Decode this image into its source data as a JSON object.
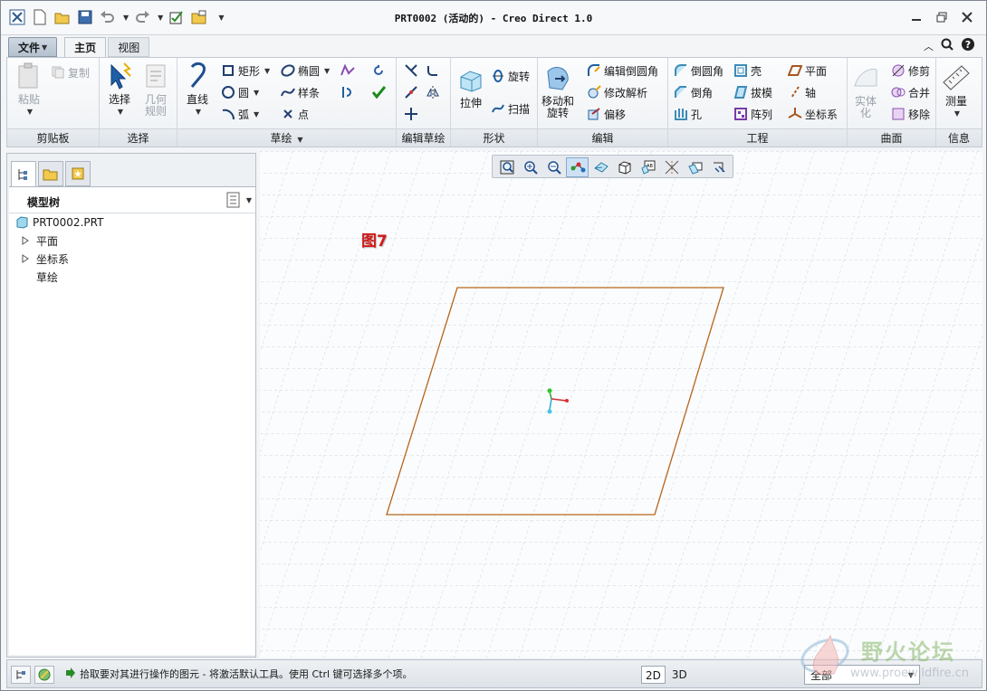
{
  "window": {
    "title": "PRT0002 (活动的) - Creo Direct 1.0"
  },
  "tabs": {
    "file": "文件",
    "home": "主页",
    "view": "视图"
  },
  "ribbon": {
    "clipboard": {
      "label": "剪贴板",
      "paste": "粘贴",
      "copy": "复制"
    },
    "select": {
      "label": "选择",
      "select": "选择",
      "geometry_rules": "几何\n规则"
    },
    "sketch": {
      "label": "草绘",
      "line": "直线",
      "rectangle": "矩形",
      "circle": "圆",
      "arc": "弧",
      "ellipse": "椭圆",
      "spline": "样条",
      "point": "点"
    },
    "edit_sketch": {
      "label": "编辑草绘"
    },
    "shapes": {
      "label": "形状",
      "extrude": "拉伸",
      "revolve": "旋转",
      "sweep": "扫描"
    },
    "edit": {
      "label": "编辑",
      "move_rotate": "移动和\n旋转",
      "edit_round": "编辑倒圆角",
      "modify_analytic": "修改解析",
      "offset": "偏移"
    },
    "engineering": {
      "label": "工程",
      "round": "倒圆角",
      "chamfer": "倒角",
      "hole": "孔",
      "shell": "壳",
      "draft": "拔模",
      "pattern": "阵列",
      "plane": "平面",
      "axis": "轴",
      "csys": "坐标系"
    },
    "surfaces": {
      "label": "曲面",
      "solidify": "实体\n化",
      "trim": "修剪",
      "merge": "合并",
      "remove": "移除"
    },
    "info": {
      "label": "信息",
      "measure": "测量"
    }
  },
  "model_tree": {
    "title": "模型树",
    "items": [
      {
        "label": "PRT0002.PRT"
      },
      {
        "label": "平面"
      },
      {
        "label": "坐标系"
      },
      {
        "label": "草绘"
      }
    ]
  },
  "canvas": {
    "figure_label": "图7"
  },
  "status": {
    "message": "拾取要对其进行操作的图元 - 将激活默认工具。使用 Ctrl 键可选择多个项。",
    "mode_2d": "2D",
    "mode_3d": "3D",
    "filter": "全部"
  },
  "watermark": {
    "name": "野火论坛",
    "url": "www.proewildfire.cn"
  },
  "colors": {
    "sketch_line": "#b5651d",
    "accent": "#1f6fc0",
    "figure_label": "#d11a1a"
  }
}
